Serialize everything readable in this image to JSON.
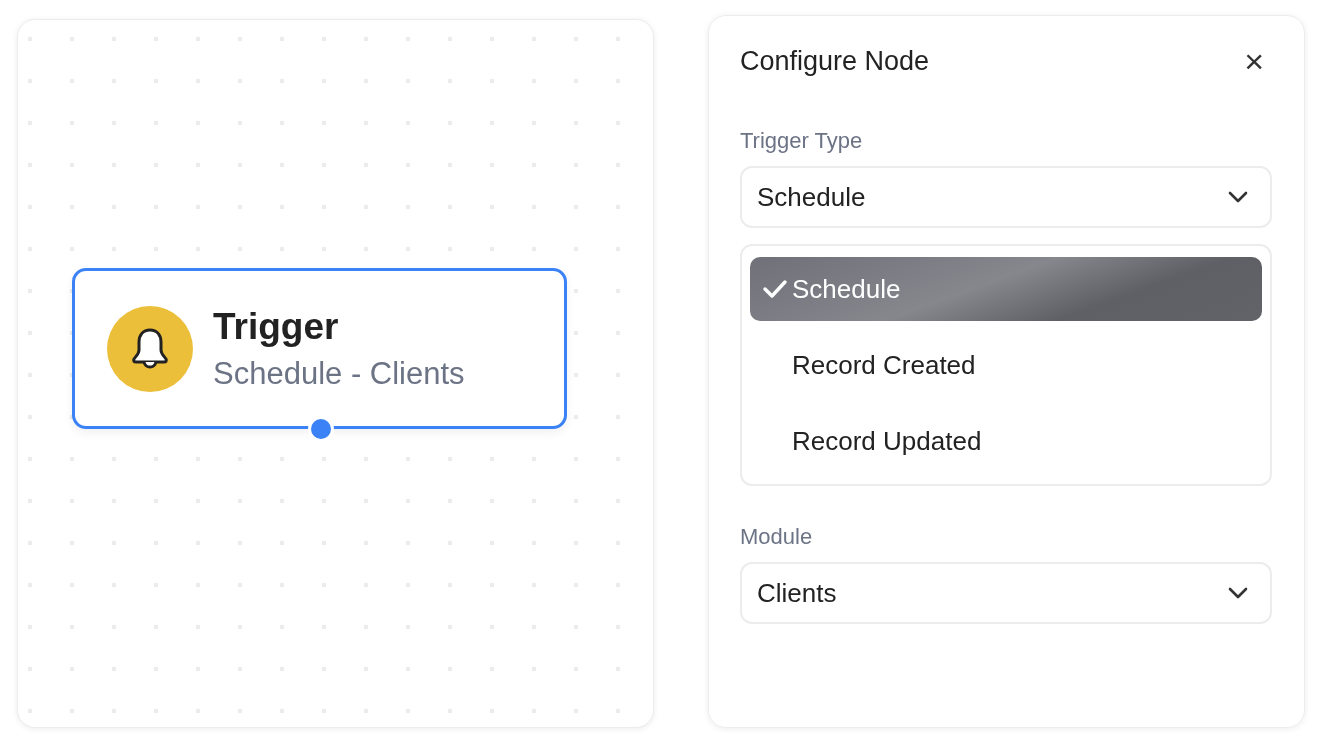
{
  "canvas": {
    "nodes": [
      {
        "title": "Trigger",
        "subtitle": "Schedule - Clients",
        "selected": true
      }
    ]
  },
  "panel": {
    "title": "Configure Node",
    "close": "×",
    "fields": [
      {
        "label": "Trigger Type",
        "value": "Schedule",
        "options": [
          {
            "label": "Schedule",
            "selected": true
          },
          {
            "label": "Record Created",
            "selected": false
          },
          {
            "label": "Record Updated",
            "selected": false
          }
        ]
      },
      {
        "label": "Module",
        "value": "Clients"
      }
    ]
  }
}
